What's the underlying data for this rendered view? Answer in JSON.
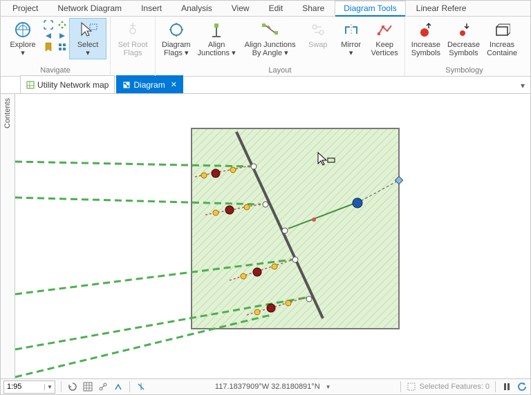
{
  "menu": {
    "items": [
      "Project",
      "Network Diagram",
      "Insert",
      "Analysis",
      "View",
      "Edit",
      "Share",
      "Diagram Tools",
      "Linear Refere"
    ],
    "active_index": 7
  },
  "ribbon": {
    "groups": [
      {
        "label": "Navigate",
        "buttons": [
          {
            "name": "explore",
            "label": "Explore\n▾",
            "interactable": true
          },
          {
            "name": "bookmarks",
            "label": "",
            "interactable": true
          },
          {
            "name": "select",
            "label": "Select\n▾",
            "interactable": true,
            "selected": true
          }
        ]
      },
      {
        "label": "",
        "buttons": [
          {
            "name": "set-root-flags",
            "label": "Set Root\nFlags",
            "interactable": false,
            "dim": true
          }
        ]
      },
      {
        "label": "Layout",
        "buttons": [
          {
            "name": "diagram-flags",
            "label": "Diagram\nFlags ▾",
            "interactable": true
          },
          {
            "name": "align-junctions",
            "label": "Align\nJunctions ▾",
            "interactable": true
          },
          {
            "name": "align-by-angle",
            "label": "Align Junctions\nBy Angle ▾",
            "interactable": true
          },
          {
            "name": "swap",
            "label": "Swap",
            "interactable": false,
            "dim": true
          },
          {
            "name": "mirror",
            "label": "Mirror\n▾",
            "interactable": true
          },
          {
            "name": "keep-vertices",
            "label": "Keep\nVertices",
            "interactable": true
          }
        ]
      },
      {
        "label": "Symbology",
        "buttons": [
          {
            "name": "increase-symbols",
            "label": "Increase\nSymbols",
            "interactable": true
          },
          {
            "name": "decrease-symbols",
            "label": "Decrease\nSymbols",
            "interactable": true
          },
          {
            "name": "increase-container",
            "label": "Increas\nContaine",
            "interactable": true
          }
        ]
      }
    ]
  },
  "doc_tabs": {
    "items": [
      {
        "label": "Utility Network map",
        "active": false
      },
      {
        "label": "Diagram",
        "active": true,
        "closeable": true
      }
    ]
  },
  "contents_panel": {
    "title": "Contents"
  },
  "statusbar": {
    "scale": "1:95",
    "coords": "117.1837909°W 32.8180891°N",
    "selected_label": "Selected Features: 0"
  },
  "colors": {
    "accent": "#0078d7",
    "highlight_fill": "#cde6f7",
    "highlight_border": "#8ec7ee"
  }
}
